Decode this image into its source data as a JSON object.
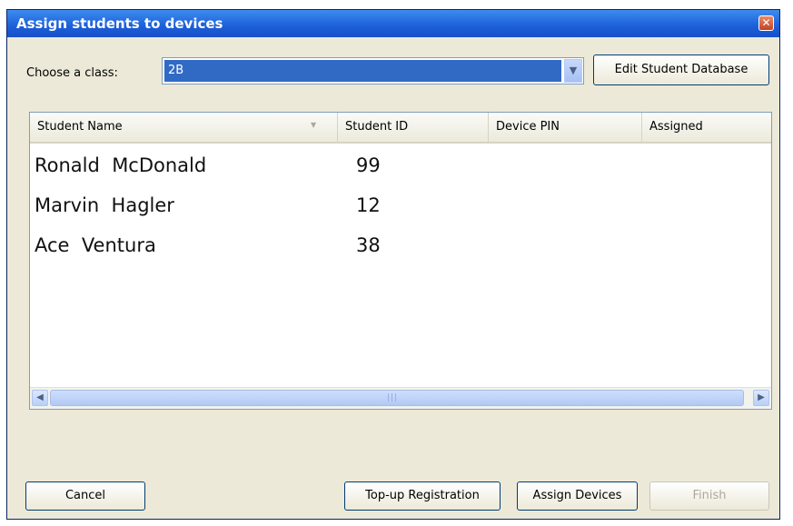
{
  "window": {
    "title": "Assign students to devices"
  },
  "class_select": {
    "label": "Choose a class:",
    "value": "2B"
  },
  "buttons": {
    "edit_db": "Edit Student Database",
    "cancel": "Cancel",
    "topup": "Top-up Registration",
    "assign": "Assign Devices",
    "finish": "Finish"
  },
  "table": {
    "columns": [
      "Student Name",
      "Student ID",
      "Device PIN",
      "Assigned"
    ],
    "rows": [
      {
        "name": "Ronald  McDonald",
        "id": "99",
        "pin": "",
        "assigned": ""
      },
      {
        "name": "Marvin  Hagler",
        "id": "12",
        "pin": "",
        "assigned": ""
      },
      {
        "name": "Ace  Ventura",
        "id": "38",
        "pin": "",
        "assigned": ""
      }
    ]
  },
  "scrollbar": {
    "grip": "|||"
  },
  "icons": {
    "close": "close-icon",
    "dropdown": "chevron-down-icon",
    "sort": "sort-descending-icon",
    "scroll_left": "chevron-left-icon",
    "scroll_right": "chevron-right-icon"
  },
  "colors": {
    "title_bar": "#1c5fd8",
    "selection": "#316ac5",
    "window_bg": "#ece9d8"
  }
}
